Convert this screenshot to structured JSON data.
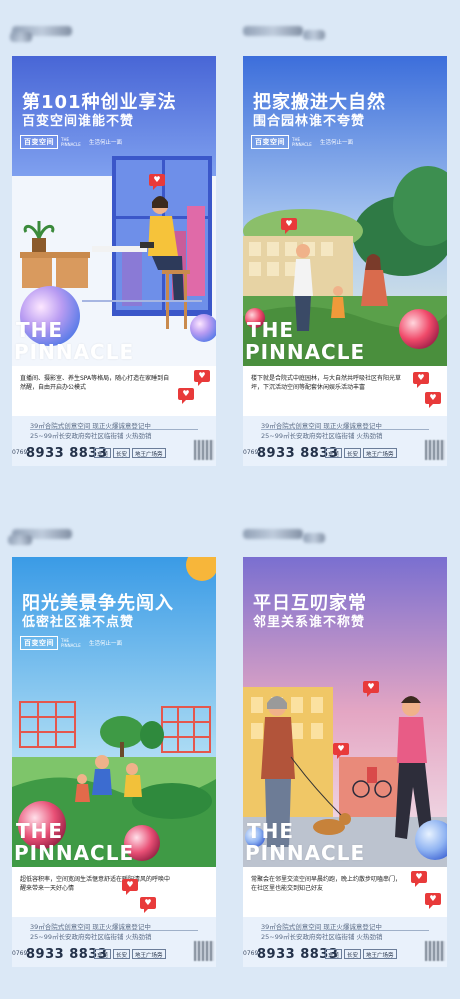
{
  "brand": {
    "cn": "百变空间",
    "en": "THE PINNACLE",
    "slogan": "生活何止一面",
    "word1": "THE",
    "word2": "PINNACLE"
  },
  "footer": {
    "line1": "39㎡合院式创意空间   现正火爆诚意登记中",
    "line2": "25~99㎡长安政府旁社区临街铺   火热劲销",
    "area_code": "0769",
    "phone": "8933 8833",
    "addr": [
      "东莞",
      "长安",
      "地王广场旁"
    ]
  },
  "posters": [
    {
      "title": "第101种创业享法",
      "subtitle": "百变空间谁能不赞",
      "desc": "直播间、摄影室、养生SPA等格局，随心打造在家睡到自然醒，自由开启办公模式",
      "colors": {
        "top": "#4f6bd8",
        "accent": "#3a55c2"
      }
    },
    {
      "title": "把家搬进大自然",
      "subtitle": "围合园林谁不夸赞",
      "desc": "楼下就是合院式中庭园林，与大自然共呼吸社区有阳光草坪，下沉活动空间等配套休闲娱乐活动丰富",
      "colors": {
        "top": "#3d6fd9",
        "accent": "#6b9e3d"
      }
    },
    {
      "title": "阳光美景争先闯入",
      "subtitle": "低密社区谁不点赞",
      "desc": "超低容积率，空间宽阔生活惬意舒适在暖阳清风的呼唤中醒来带来一天好心情",
      "colors": {
        "top": "#3a9be6",
        "accent": "#4fb04a"
      }
    },
    {
      "title": "平日互叨家常",
      "subtitle": "邻里关系谁不称赞",
      "desc": "常聚会在邻里交流空间早晨约跑，晚上约散步叨嗑串门，在社区里也能交到知己好友",
      "colors": {
        "top": "#7a6fd0",
        "accent": "#d06a8b"
      }
    }
  ]
}
